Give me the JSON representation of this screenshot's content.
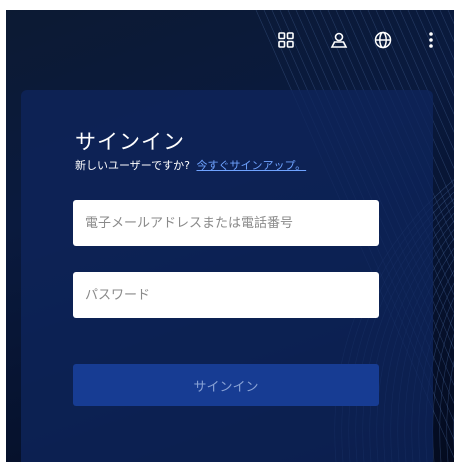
{
  "header": {
    "icons": [
      "apps-grid-icon",
      "user-location-icon",
      "globe-icon",
      "more-vertical-icon"
    ]
  },
  "signin": {
    "title": "サインイン",
    "prompt": "新しいユーザーですか?",
    "signup_link": "今すぐサインアップ。",
    "email_placeholder": "電子メールアドレスまたは電話番号",
    "password_placeholder": "パスワード",
    "submit_label": "サインイン"
  },
  "colors": {
    "background": "#0a1a3e",
    "card": "#0e255c",
    "button": "#173c93",
    "button_text": "#8aa3d6",
    "link": "#6fa3ff"
  }
}
